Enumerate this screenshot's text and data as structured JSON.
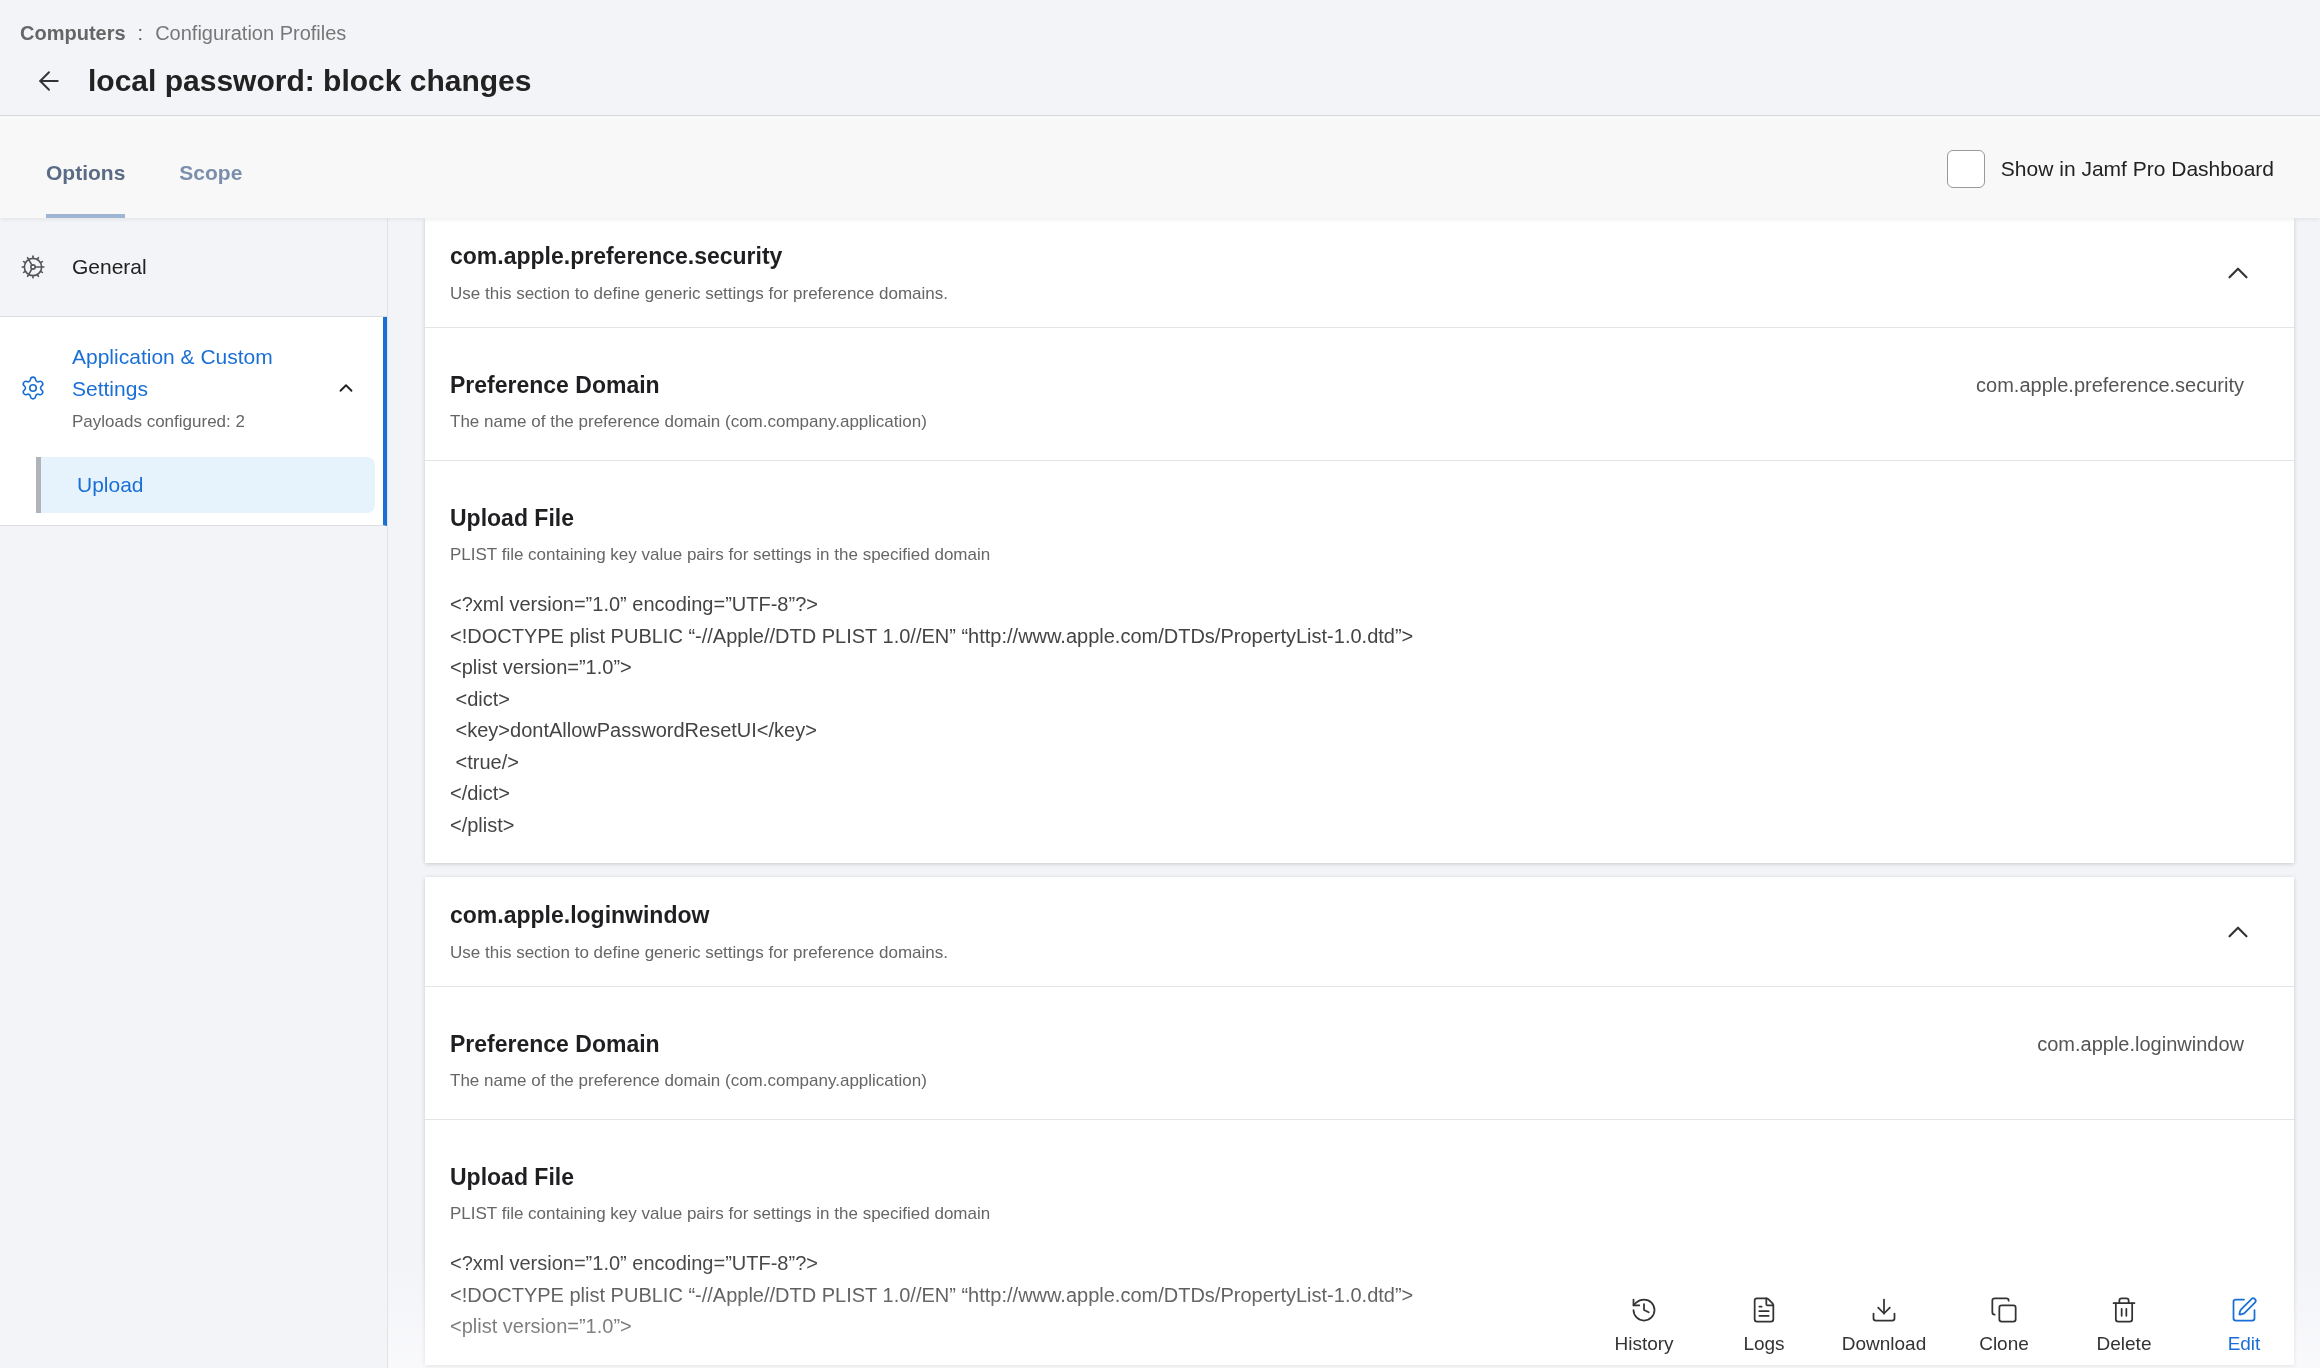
{
  "breadcrumb": {
    "section": "Computers",
    "separator": ":",
    "page": "Configuration Profiles"
  },
  "title": "local password: block changes",
  "tabs": [
    {
      "label": "Options",
      "selected": true
    },
    {
      "label": "Scope",
      "selected": false
    }
  ],
  "dashboard_checkbox": {
    "label": "Show in Jamf Pro Dashboard",
    "checked": false
  },
  "sidebar": {
    "items": [
      {
        "kind": "general",
        "label": "General",
        "selected": false
      },
      {
        "kind": "settings",
        "label": "Application & Custom Settings",
        "subtitle": "Payloads configured: 2",
        "selected": true,
        "expanded": true,
        "children": [
          {
            "label": "Upload",
            "selected": true
          }
        ]
      }
    ]
  },
  "cards": [
    {
      "title": "com.apple.preference.security",
      "description": "Use this section to define generic settings for preference domains.",
      "expanded": true,
      "fields": [
        {
          "kind": "value",
          "label": "Preference Domain",
          "hint": "The name of the preference domain (com.company.application)",
          "value": "com.apple.preference.security"
        },
        {
          "kind": "code",
          "label": "Upload File",
          "hint": "PLIST file containing key value pairs for settings in the specified domain",
          "lines": [
            "<?xml version=”1.0” encoding=”UTF-8”?>",
            "<!DOCTYPE plist PUBLIC “-//Apple//DTD PLIST 1.0//EN” “http://www.apple.com/DTDs/PropertyList-1.0.dtd”>",
            "<plist version=”1.0”>",
            " <dict>",
            " <key>dontAllowPasswordResetUI</key>",
            " <true/>",
            "</dict>",
            "</plist>"
          ]
        }
      ]
    },
    {
      "title": "com.apple.loginwindow",
      "description": "Use this section to define generic settings for preference domains.",
      "expanded": true,
      "fields": [
        {
          "kind": "value",
          "label": "Preference Domain",
          "hint": "The name of the preference domain (com.company.application)",
          "value": "com.apple.loginwindow"
        },
        {
          "kind": "code",
          "label": "Upload File",
          "hint": "PLIST file containing key value pairs for settings in the specified domain",
          "lines": [
            "<?xml version=”1.0” encoding=”UTF-8”?>",
            "<!DOCTYPE plist PUBLIC “-//Apple//DTD PLIST 1.0//EN” “http://www.apple.com/DTDs/PropertyList-1.0.dtd”>",
            "<plist version=”1.0”>"
          ]
        }
      ]
    }
  ],
  "toolbar": [
    {
      "kind": "history",
      "label": "History"
    },
    {
      "kind": "logs",
      "label": "Logs"
    },
    {
      "kind": "download",
      "label": "Download"
    },
    {
      "kind": "clone",
      "label": "Clone"
    },
    {
      "kind": "delete",
      "label": "Delete"
    },
    {
      "kind": "edit",
      "label": "Edit"
    }
  ]
}
